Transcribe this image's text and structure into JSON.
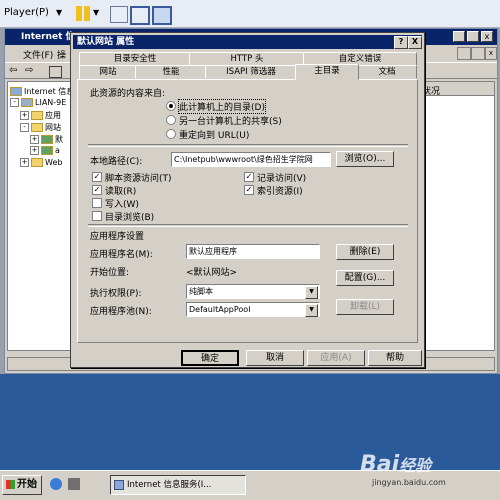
{
  "player": {
    "label": "Player(P)"
  },
  "bg_window": {
    "title": "Internet 信",
    "menu": [
      "文件(F)",
      "操"
    ],
    "tree": [
      "Internet 信息",
      "LIAN-9E",
      "应用",
      "网站",
      "默",
      "a",
      "Web"
    ],
    "right_header": "状况"
  },
  "dialog": {
    "title": "默认网站 属性",
    "title_buttons": {
      "help": "?",
      "close": "X"
    },
    "tabs_row1": [
      "目录安全性",
      "HTTP 头",
      "自定义错误"
    ],
    "tabs_row2": [
      "网站",
      "性能",
      "ISAPI 筛选器",
      "主目录",
      "文档"
    ],
    "active_tab": "主目录",
    "content_source_label": "此资源的内容来自:",
    "radios": [
      {
        "label": "此计算机上的目录(D)",
        "checked": true
      },
      {
        "label": "另一台计算机上的共享(S)",
        "checked": false
      },
      {
        "label": "重定向到 URL(U)",
        "checked": false
      }
    ],
    "local_path_label": "本地路径(C):",
    "local_path_value": "C:\\Inetpub\\wwwroot\\绿色招生学院网",
    "browse_button": "浏览(O)...",
    "checkboxes_left": [
      {
        "label": "脚本资源访问(T)",
        "checked": true
      },
      {
        "label": "读取(R)",
        "checked": true
      },
      {
        "label": "写入(W)",
        "checked": false
      },
      {
        "label": "目录浏览(B)",
        "checked": false
      }
    ],
    "checkboxes_right": [
      {
        "label": "记录访问(V)",
        "checked": true
      },
      {
        "label": "索引资源(I)",
        "checked": true
      }
    ],
    "app_settings_label": "应用程序设置",
    "app_name_label": "应用程序名(M):",
    "app_name_value": "默认应用程序",
    "remove_button": "删除(E)",
    "start_point_label": "开始位置:",
    "start_point_value": "<默认网站>",
    "config_button": "配置(G)...",
    "exec_perm_label": "执行权限(P):",
    "exec_perm_value": "纯脚本",
    "app_pool_label": "应用程序池(N):",
    "app_pool_value": "DefaultAppPool",
    "unload_button": "卸载(L)",
    "ok_button": "确定",
    "cancel_button": "取消",
    "apply_button": "应用(A)",
    "help_button": "帮助"
  },
  "taskbar": {
    "start": "开始",
    "task_item": "Internet 信息服务(I..."
  },
  "watermark": {
    "text": "Bai",
    "text2": "经验",
    "url": "jingyan.baidu.com"
  },
  "colors": {
    "titlebar": "#0a246a",
    "face": "#d4d0c8",
    "desktop": "#2a5a9a"
  }
}
